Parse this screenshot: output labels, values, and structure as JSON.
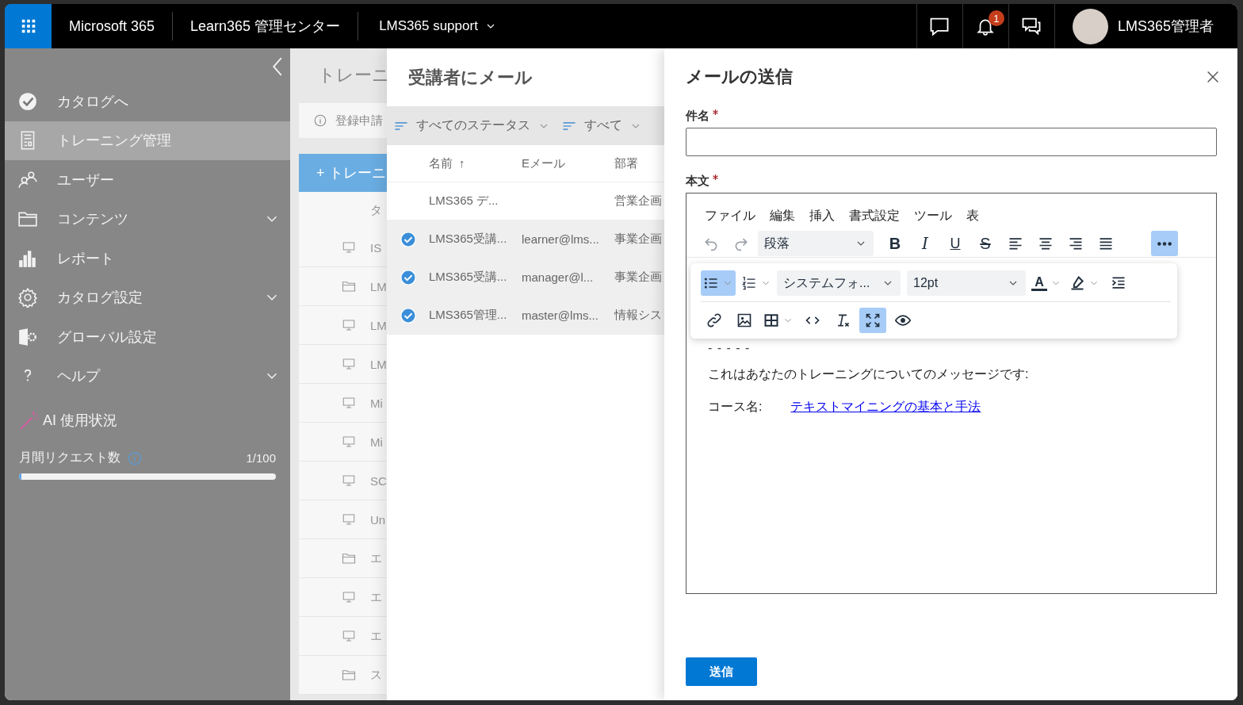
{
  "topbar": {
    "app_name": "Microsoft 365",
    "center_name": "Learn365 管理センター",
    "tenant": "LMS365 support",
    "notification_count": "1",
    "user_name": "LMS365管理者"
  },
  "sidebar": {
    "items": [
      {
        "label": "カタログへ",
        "selected": false,
        "has_submenu": false
      },
      {
        "label": "トレーニング管理",
        "selected": true,
        "has_submenu": false
      },
      {
        "label": "ユーザー",
        "selected": false,
        "has_submenu": false
      },
      {
        "label": "コンテンツ",
        "selected": false,
        "has_submenu": true
      },
      {
        "label": "レポート",
        "selected": false,
        "has_submenu": false
      },
      {
        "label": "カタログ設定",
        "selected": false,
        "has_submenu": true
      },
      {
        "label": "グローバル設定",
        "selected": false,
        "has_submenu": false
      },
      {
        "label": "ヘルプ",
        "selected": false,
        "has_submenu": true
      }
    ],
    "ai_usage": {
      "title": "AI 使用状況",
      "metric": "月間リクエスト数",
      "count": "1/100",
      "level": 0.01
    }
  },
  "background_page": {
    "title": "トレーニ",
    "notice": "登録申請",
    "add_button": "+ トレーニ",
    "column_1": "タ",
    "rows": [
      {
        "kind": "monitor",
        "text": "IS"
      },
      {
        "kind": "folder",
        "text": "LM"
      },
      {
        "kind": "monitor",
        "text": "LM"
      },
      {
        "kind": "monitor",
        "text": "LM"
      },
      {
        "kind": "monitor",
        "text": "Mi"
      },
      {
        "kind": "monitor",
        "text": "Mi"
      },
      {
        "kind": "monitor",
        "text": "SC"
      },
      {
        "kind": "monitor",
        "text": "Un"
      },
      {
        "kind": "folder",
        "text": "エ"
      },
      {
        "kind": "monitor",
        "text": "エ"
      },
      {
        "kind": "monitor",
        "text": "エ"
      },
      {
        "kind": "folder",
        "text": "ス"
      }
    ]
  },
  "recipients_panel": {
    "title": "受講者にメール",
    "filters": [
      "すべてのステータス",
      "すべて"
    ],
    "columns": [
      {
        "label": "名前",
        "sort": "↑"
      },
      {
        "label": "Eメール"
      },
      {
        "label": "部署"
      }
    ],
    "rows": [
      {
        "name": "LMS365 デ...",
        "department": "営業企画",
        "selected": false
      },
      {
        "name": "LMS365受講...",
        "email": "learner@lms...",
        "department": "事業企画",
        "selected": true
      },
      {
        "name": "LMS365受講...",
        "email": "manager@l...",
        "department": "事業企画",
        "selected": true
      },
      {
        "name": "LMS365管理...",
        "email": "master@lms...",
        "department": "情報シス",
        "selected": true
      }
    ]
  },
  "mail_panel": {
    "title": "メールの送信",
    "subject": {
      "label": "件名",
      "required": true
    },
    "body": {
      "label": "本文",
      "required": true
    },
    "editor": {
      "menus": [
        "ファイル",
        "編集",
        "挿入",
        "書式設定",
        "ツール",
        "表"
      ],
      "toolbar": [
        {
          "kind": "undo",
          "active": false,
          "disabled": true
        },
        {
          "kind": "redo",
          "active": false,
          "disabled": true
        },
        {
          "kind": "select",
          "value": "段落",
          "active": false,
          "disabled": false
        },
        {
          "kind": "bold",
          "label": "B",
          "active": false,
          "disabled": false
        },
        {
          "kind": "italic",
          "label": "I",
          "active": false,
          "disabled": false
        },
        {
          "kind": "underline",
          "label": "U",
          "active": false,
          "disabled": false
        },
        {
          "kind": "strike",
          "label": "S",
          "active": false,
          "disabled": false
        },
        {
          "kind": "align-left",
          "active": false,
          "disabled": false
        },
        {
          "kind": "align-center",
          "active": false,
          "disabled": false
        },
        {
          "kind": "align-right",
          "active": false,
          "disabled": false
        },
        {
          "kind": "justify",
          "active": false,
          "disabled": false
        },
        {
          "kind": "more",
          "active": true,
          "disabled": false
        }
      ],
      "overflow_rows": [
        [
          {
            "kind": "bullet-list",
            "active": true,
            "disabled": false
          },
          {
            "kind": "numbered-list",
            "active": false,
            "disabled": false
          },
          {
            "kind": "font-select",
            "value": "システムフォ...",
            "active": false,
            "disabled": false
          },
          {
            "kind": "size-select",
            "value": "12pt",
            "active": false,
            "disabled": false
          },
          {
            "kind": "font-color",
            "label": "A",
            "active": false,
            "disabled": false
          },
          {
            "kind": "highlight",
            "active": false,
            "disabled": false
          },
          {
            "kind": "indent",
            "active": false,
            "disabled": false
          }
        ],
        [
          {
            "kind": "link",
            "active": false,
            "disabled": false
          },
          {
            "kind": "image",
            "active": false,
            "disabled": false
          },
          {
            "kind": "table",
            "active": false,
            "disabled": false
          },
          {
            "kind": "code",
            "active": false,
            "disabled": false
          },
          {
            "kind": "clear-format",
            "active": false,
            "disabled": false
          },
          {
            "kind": "fullscreen",
            "active": true,
            "disabled": false
          },
          {
            "kind": "preview",
            "active": false,
            "disabled": false
          }
        ]
      ],
      "content": {
        "separator": "- - - - -",
        "message": "これはあなたのトレーニングについてのメッセージです:",
        "course_label": "コース名:",
        "course_link": "テキストマイニングの基本と手法"
      }
    },
    "send_button": "送信"
  }
}
